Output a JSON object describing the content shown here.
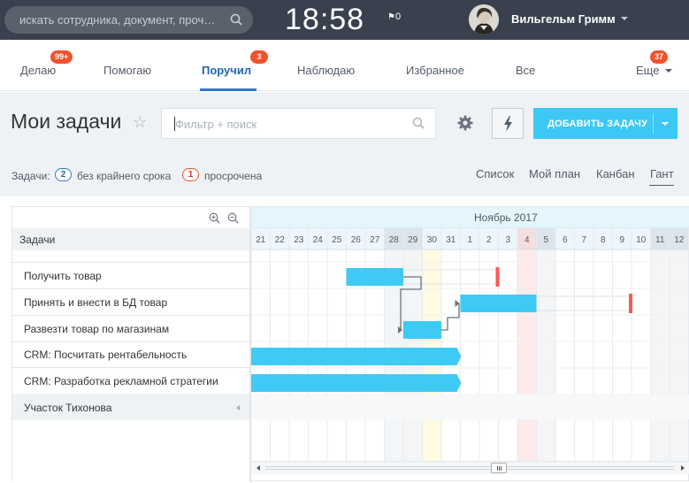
{
  "header": {
    "search_placeholder": "искать сотрудника, документ, проч…",
    "clock": "18:58",
    "flag_count": "0",
    "user_name": "Вильгельм Гримм"
  },
  "tabs": [
    {
      "label": "Делаю",
      "badge": "99+"
    },
    {
      "label": "Помогаю",
      "badge": ""
    },
    {
      "label": "Поручил",
      "badge": "3",
      "active": true
    },
    {
      "label": "Наблюдаю",
      "badge": ""
    },
    {
      "label": "Избранное",
      "badge": ""
    },
    {
      "label": "Все",
      "badge": ""
    },
    {
      "label": "Еще",
      "badge": "37"
    }
  ],
  "title": {
    "text": "Мои задачи",
    "filter_placeholder": "Фильтр + поиск",
    "add_button": "ДОБАВИТЬ ЗАДАЧУ"
  },
  "counters": {
    "prefix": "Задачи:",
    "no_deadline_count": "2",
    "no_deadline_label": "без крайнего срока",
    "overdue_count": "1",
    "overdue_label": "просрочена"
  },
  "views": [
    "Список",
    "Мой план",
    "Канбан",
    "Гант"
  ],
  "active_view": "Гант",
  "gantt": {
    "tasks_header": "Задачи",
    "month": "Ноябрь 2017",
    "days": [
      "21",
      "22",
      "23",
      "24",
      "25",
      "26",
      "27",
      "28",
      "29",
      "30",
      "31",
      "1",
      "2",
      "3",
      "4",
      "5",
      "6",
      "7",
      "8",
      "9",
      "10",
      "11",
      "12"
    ],
    "weekend_days": [
      "28",
      "29",
      "4",
      "5",
      "11",
      "12"
    ],
    "today": "30",
    "holiday": "4",
    "tasks": [
      {
        "name": "Получить товар",
        "start": "2017-10-26",
        "end": "2017-10-28",
        "deadline": "2017-11-02"
      },
      {
        "name": "Принять и внести в БД товар",
        "start": "2017-11-01",
        "end": "2017-11-04",
        "deadline": "2017-11-09"
      },
      {
        "name": "Развезти товар по магазинам",
        "start": "2017-10-29",
        "end": "2017-10-30",
        "deadline": ""
      },
      {
        "name": "CRM: Посчитать рентабельность",
        "start": "",
        "end": "2017-10-31",
        "deadline": ""
      },
      {
        "name": "CRM: Разработка рекламной стратегии",
        "start": "",
        "end": "2017-10-31",
        "deadline": ""
      }
    ],
    "dependencies": [
      {
        "from": 0,
        "to": 2
      },
      {
        "from": 2,
        "to": 1
      }
    ],
    "section": "Участок Тихонова"
  },
  "colors": {
    "bar": "#3fcaf3",
    "deadline": "#ff5752",
    "accent": "#2f75c9",
    "button": "#3bc8f5",
    "badge": "#f0522d",
    "topbar": "#38414d"
  }
}
